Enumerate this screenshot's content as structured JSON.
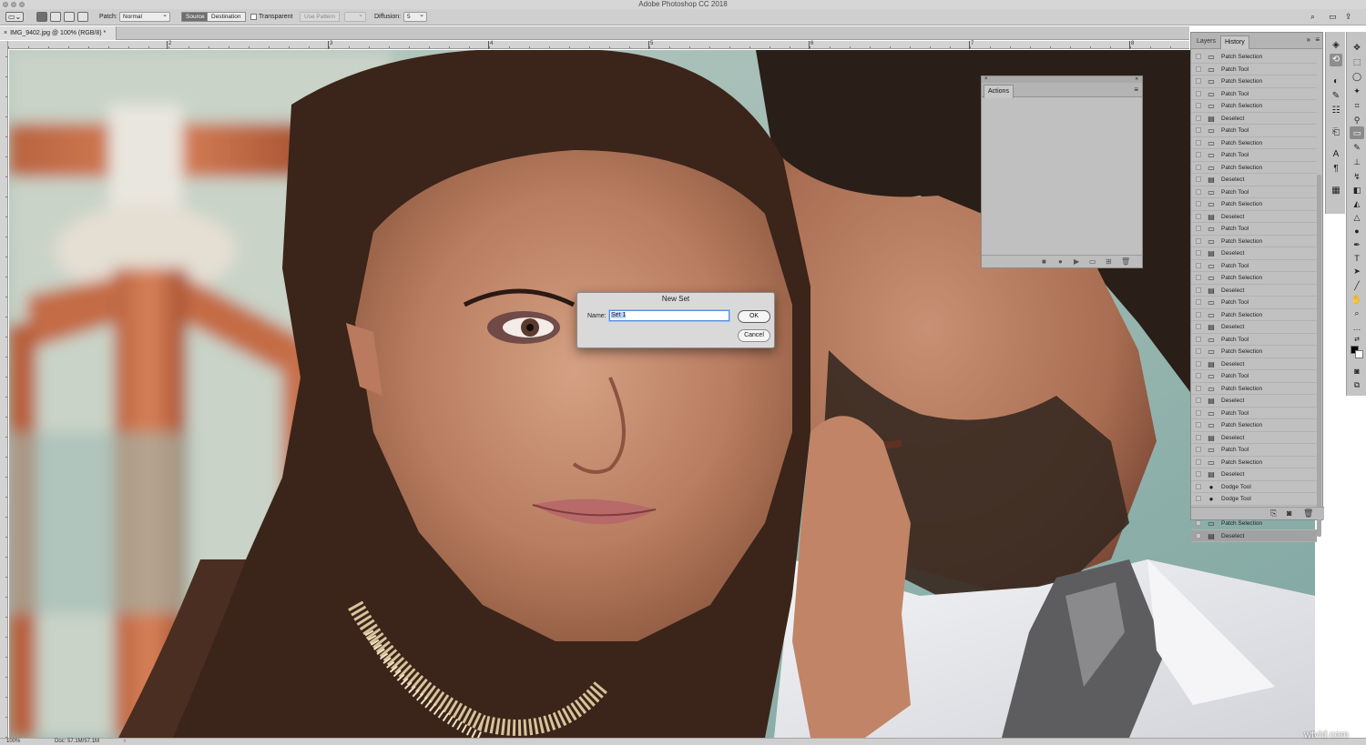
{
  "window": {
    "title": "Adobe Photoshop CC 2018"
  },
  "options_bar": {
    "patch_label": "Patch:",
    "patch_mode": "Normal",
    "source_label": "Source",
    "destination_label": "Destination",
    "transparent_label": "Transparent",
    "use_pattern_label": "Use Pattern",
    "diffusion_label": "Diffusion:",
    "diffusion_value": "5"
  },
  "document": {
    "tab_label": "IMG_9402.jpg @ 100% (RGB/8) *"
  },
  "ruler": {
    "h_ticks": [
      "2",
      "3",
      "4",
      "5",
      "6",
      "7",
      "8",
      "9"
    ]
  },
  "status": {
    "zoom": "100%",
    "doc_info": "Doc: 57.1M/57.1M"
  },
  "history_panel": {
    "tab_layers": "Layers",
    "tab_history": "History",
    "items": [
      {
        "label": "Patch Selection",
        "icon": "patch-icon"
      },
      {
        "label": "Patch Tool",
        "icon": "patch-icon"
      },
      {
        "label": "Patch Selection",
        "icon": "patch-icon"
      },
      {
        "label": "Patch Tool",
        "icon": "patch-icon"
      },
      {
        "label": "Patch Selection",
        "icon": "patch-icon"
      },
      {
        "label": "Deselect",
        "icon": "document-icon"
      },
      {
        "label": "Patch Tool",
        "icon": "patch-icon"
      },
      {
        "label": "Patch Selection",
        "icon": "patch-icon"
      },
      {
        "label": "Patch Tool",
        "icon": "patch-icon"
      },
      {
        "label": "Patch Selection",
        "icon": "patch-icon"
      },
      {
        "label": "Deselect",
        "icon": "document-icon"
      },
      {
        "label": "Patch Tool",
        "icon": "patch-icon"
      },
      {
        "label": "Patch Selection",
        "icon": "patch-icon"
      },
      {
        "label": "Deselect",
        "icon": "document-icon"
      },
      {
        "label": "Patch Tool",
        "icon": "patch-icon"
      },
      {
        "label": "Patch Selection",
        "icon": "patch-icon"
      },
      {
        "label": "Deselect",
        "icon": "document-icon"
      },
      {
        "label": "Patch Tool",
        "icon": "patch-icon"
      },
      {
        "label": "Patch Selection",
        "icon": "patch-icon"
      },
      {
        "label": "Deselect",
        "icon": "document-icon"
      },
      {
        "label": "Patch Tool",
        "icon": "patch-icon"
      },
      {
        "label": "Patch Selection",
        "icon": "patch-icon"
      },
      {
        "label": "Deselect",
        "icon": "document-icon"
      },
      {
        "label": "Patch Tool",
        "icon": "patch-icon"
      },
      {
        "label": "Patch Selection",
        "icon": "patch-icon"
      },
      {
        "label": "Deselect",
        "icon": "document-icon"
      },
      {
        "label": "Patch Tool",
        "icon": "patch-icon"
      },
      {
        "label": "Patch Selection",
        "icon": "patch-icon"
      },
      {
        "label": "Deselect",
        "icon": "document-icon"
      },
      {
        "label": "Patch Tool",
        "icon": "patch-icon"
      },
      {
        "label": "Patch Selection",
        "icon": "patch-icon"
      },
      {
        "label": "Deselect",
        "icon": "document-icon"
      },
      {
        "label": "Patch Tool",
        "icon": "patch-icon"
      },
      {
        "label": "Patch Selection",
        "icon": "patch-icon"
      },
      {
        "label": "Deselect",
        "icon": "document-icon"
      },
      {
        "label": "Dodge Tool",
        "icon": "dodge-icon"
      },
      {
        "label": "Dodge Tool",
        "icon": "dodge-icon"
      },
      {
        "label": "Patch Tool",
        "icon": "patch-icon"
      },
      {
        "label": "Patch Selection",
        "icon": "patch-icon"
      },
      {
        "label": "Deselect",
        "icon": "document-icon",
        "selected": true
      }
    ]
  },
  "actions_panel": {
    "tab_actions": "Actions"
  },
  "dialog": {
    "title": "New Set",
    "name_label": "Name:",
    "name_value": "Set 1",
    "ok_label": "OK",
    "cancel_label": "Cancel"
  },
  "colors": {
    "foreground": "#000000",
    "background": "#ffffff",
    "focus_ring": "#5a8dd6"
  },
  "watermark": {
    "text": "wtvid.com"
  }
}
